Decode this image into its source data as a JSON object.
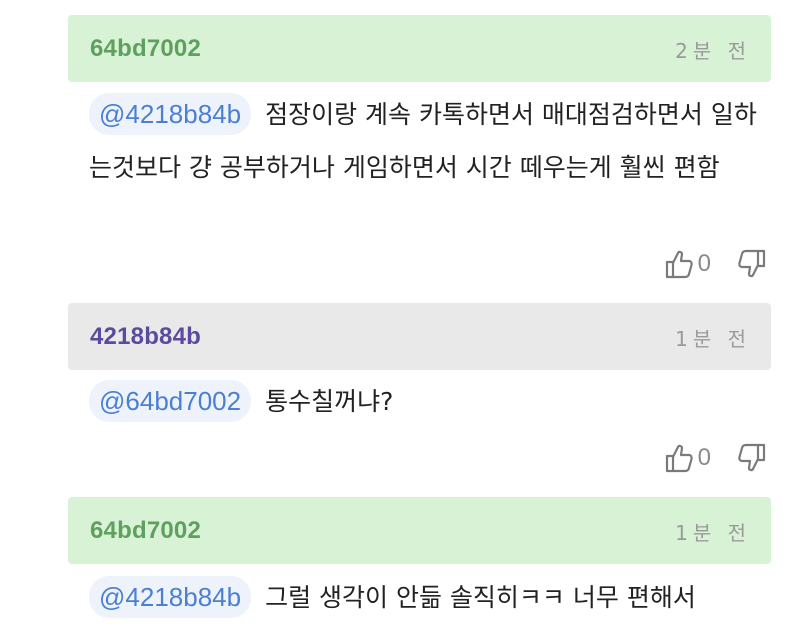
{
  "comments": [
    {
      "author": "64bd7002",
      "time": "2분 전",
      "mention": "@4218b84b",
      "text": "점장이랑 계속 카톡하면서 매대점검하면서 일하는것보다 걍 공부하거나 게임하면서 시간 떼우는게 훨씬 편함",
      "likes": "0"
    },
    {
      "author": "4218b84b",
      "time": "1분 전",
      "mention": "@64bd7002",
      "text": "통수칠꺼냐?",
      "likes": "0"
    },
    {
      "author": "64bd7002",
      "time": "1분 전",
      "mention": "@4218b84b",
      "text": "그럴 생각이 안듦 솔직히ㅋㅋ 너무 편해서"
    }
  ],
  "colors": {
    "own_header": "#d8f2d6",
    "other_header": "#e9e9e9",
    "mention_text": "#4b7fd3"
  },
  "icons": {
    "like": "thumbs-up-icon",
    "dislike": "thumbs-down-icon"
  }
}
